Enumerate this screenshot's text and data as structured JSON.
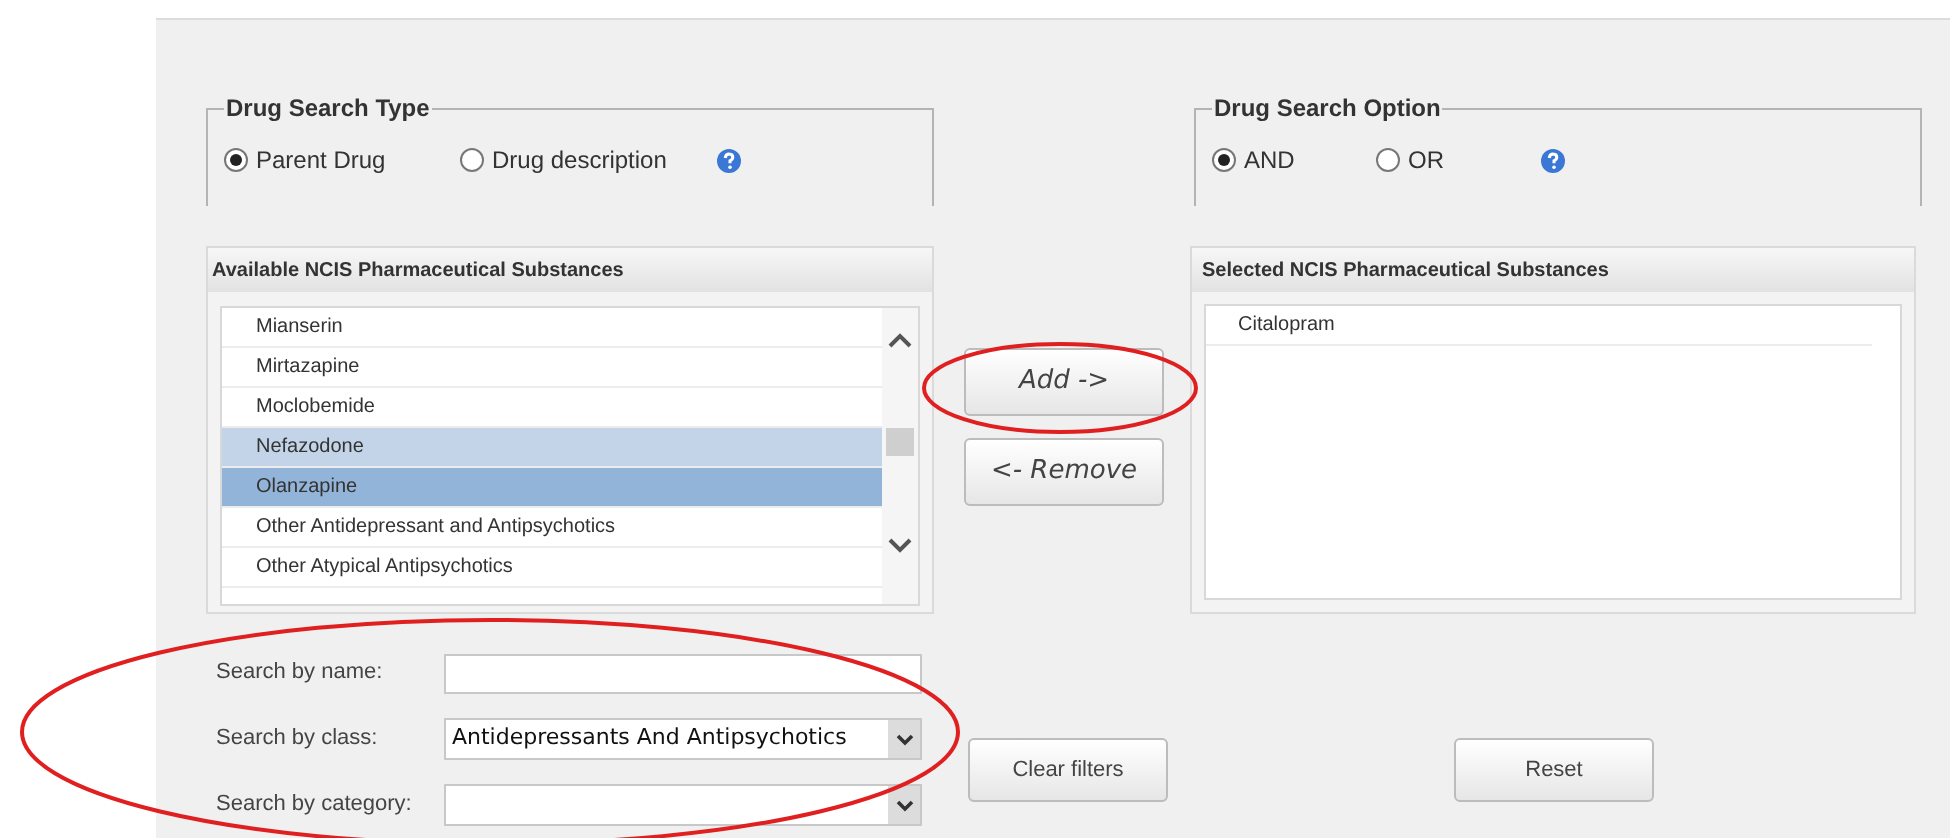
{
  "search_type": {
    "legend": "Drug Search Type",
    "options": [
      {
        "label": "Parent Drug",
        "selected": true
      },
      {
        "label": "Drug description",
        "selected": false
      }
    ]
  },
  "search_option": {
    "legend": "Drug Search Option",
    "options": [
      {
        "label": "AND",
        "selected": true
      },
      {
        "label": "OR",
        "selected": false
      }
    ]
  },
  "available": {
    "title": "Available NCIS Pharmaceutical Substances",
    "items": [
      {
        "label": "Mianserin",
        "selected": false
      },
      {
        "label": "Mirtazapine",
        "selected": false
      },
      {
        "label": "Moclobemide",
        "selected": false
      },
      {
        "label": "Nefazodone",
        "selected": false,
        "hovered": true
      },
      {
        "label": "Olanzapine",
        "selected": true
      },
      {
        "label": "Other Antidepressant and Antipsychotics",
        "selected": false
      },
      {
        "label": "Other Atypical Antipsychotics",
        "selected": false
      }
    ]
  },
  "move_buttons": [
    "Add ->",
    "<- Remove"
  ],
  "selected_list": {
    "title": "Selected NCIS Pharmaceutical Substances",
    "items": [
      "Citalopram"
    ]
  },
  "filters": [
    {
      "label": "Search by name:",
      "kind": "text"
    },
    {
      "label": "Search by class:",
      "kind": "select",
      "value": "Antidepressants And Antipsychotics"
    },
    {
      "label": "Search by category:",
      "kind": "select"
    }
  ],
  "clear_button": "Clear filters",
  "reset_button": "Reset"
}
